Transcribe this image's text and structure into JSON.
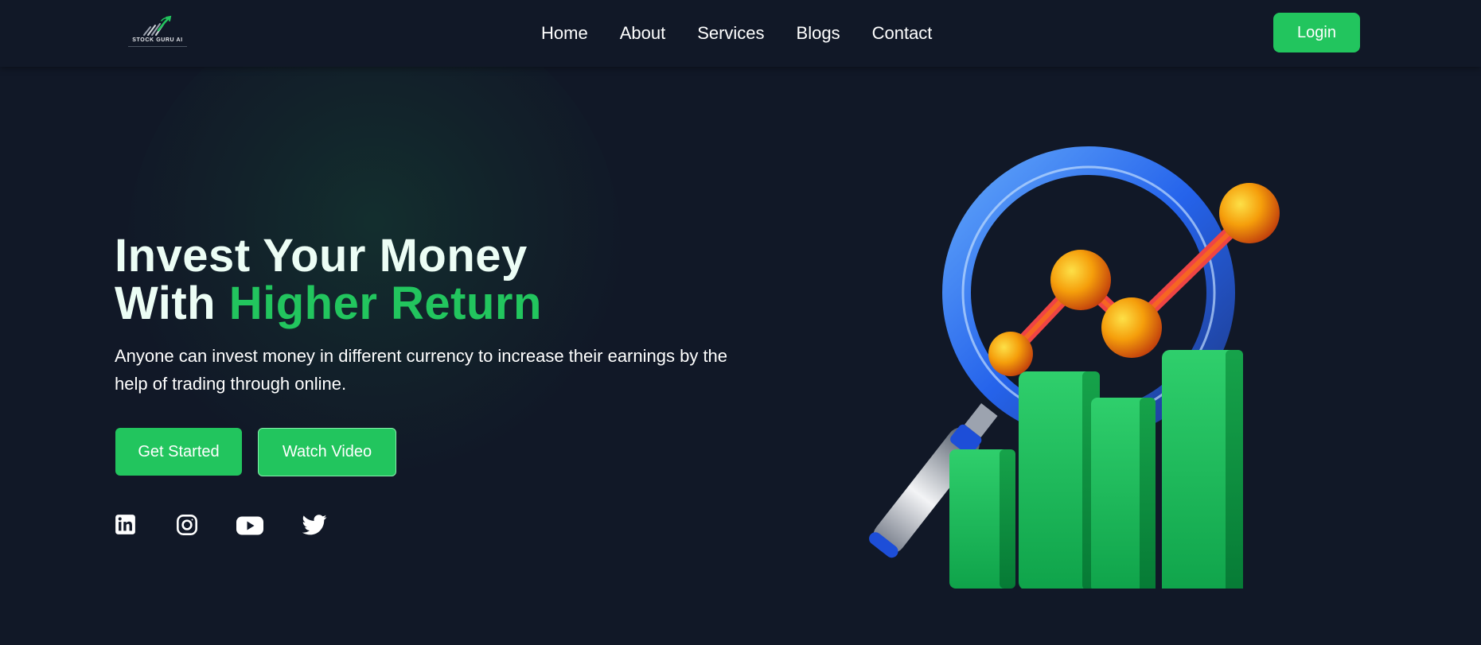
{
  "brand": {
    "name": "STOCK GURU AI",
    "logo_icon": "bull-chart-logo-icon"
  },
  "nav": {
    "links": [
      "Home",
      "About",
      "Services",
      "Blogs",
      "Contact"
    ],
    "login_label": "Login"
  },
  "hero": {
    "title_line1": "Invest Your Money",
    "title_line2_prefix": "With ",
    "title_line2_accent": "Higher Return",
    "description": "Anyone can invest money in different currency to increase their earnings by the help of trading through online.",
    "primary_button": "Get Started",
    "secondary_button": "Watch Video",
    "illustration": "magnifying-glass-bar-chart-illustration"
  },
  "socials": [
    {
      "name": "linkedin",
      "icon": "linkedin-icon"
    },
    {
      "name": "instagram",
      "icon": "instagram-icon"
    },
    {
      "name": "youtube",
      "icon": "youtube-icon"
    },
    {
      "name": "twitter",
      "icon": "twitter-icon"
    }
  ],
  "colors": {
    "background": "#111827",
    "accent": "#22c55e",
    "heading": "#ecfdf5",
    "text": "#ffffff"
  }
}
